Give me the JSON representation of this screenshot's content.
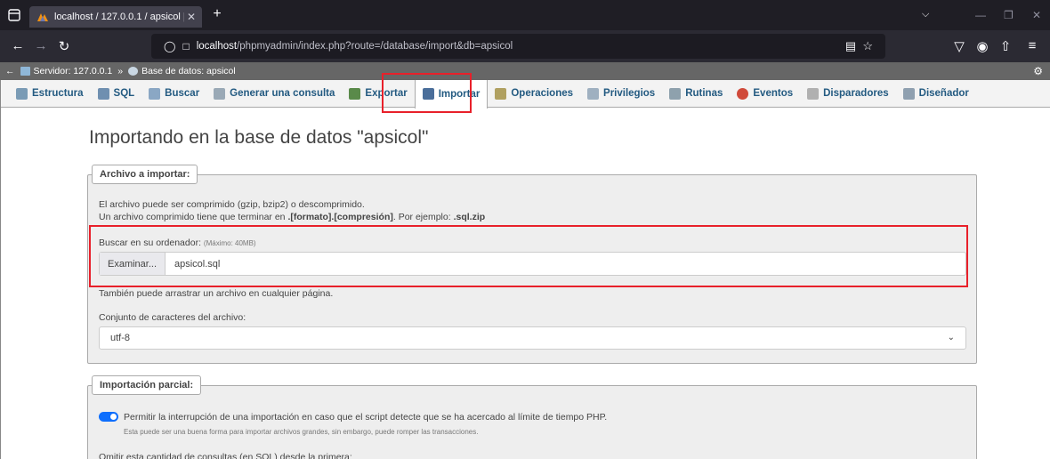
{
  "browser": {
    "tab_title": "localhost / 127.0.0.1 / apsicol | ",
    "tab_close": "✕",
    "new_tab": "+",
    "url_host": "localhost",
    "url_path": "/phpmyadmin/index.php?route=/database/import&db=apsicol"
  },
  "breadcrumb": {
    "server": "Servidor: 127.0.0.1",
    "separator": "»",
    "database": "Base de datos: apsicol"
  },
  "tabs": [
    {
      "label": "Estructura",
      "color": "#7a9bb5"
    },
    {
      "label": "SQL",
      "color": "#6f8fb0"
    },
    {
      "label": "Buscar",
      "color": "#8aa7c4"
    },
    {
      "label": "Generar una consulta",
      "color": "#9aa9b6"
    },
    {
      "label": "Exportar",
      "color": "#5a8a4a"
    },
    {
      "label": "Importar",
      "color": "#4a6e9a"
    },
    {
      "label": "Operaciones",
      "color": "#b0a060"
    },
    {
      "label": "Privilegios",
      "color": "#9fb0c0"
    },
    {
      "label": "Rutinas",
      "color": "#8ea1ad"
    },
    {
      "label": "Eventos",
      "color": "#d04a3a"
    },
    {
      "label": "Disparadores",
      "color": "#b0b0b0"
    },
    {
      "label": "Diseñador",
      "color": "#8fa0b0"
    }
  ],
  "page_title": "Importando en la base de datos \"apsicol\"",
  "file_section": {
    "legend": "Archivo a importar:",
    "line1": "El archivo puede ser comprimido (gzip, bzip2) o descomprimido.",
    "line2_prefix": "Un archivo comprimido tiene que terminar en ",
    "line2_format": ".[formato].[compresión]",
    "line2_mid": ". Por ejemplo: ",
    "line2_example": ".sql.zip",
    "browse_label": "Buscar en su ordenador:",
    "max_size": "(Máximo: 40MB)",
    "browse_button": "Examinar...",
    "file_name": "apsicol.sql",
    "drag_hint": "También puede arrastrar un archivo en cualquier página.",
    "charset_label": "Conjunto de caracteres del archivo:",
    "charset_value": "utf-8"
  },
  "partial_section": {
    "legend": "Importación parcial:",
    "allow_interrupt": "Permitir la interrupción de una importación en caso que el script detecte que se ha acercado al límite de tiempo PHP.",
    "allow_interrupt_note": "Esta puede ser una buena forma para importar archivos grandes, sin embargo, puede romper las transacciones.",
    "skip_queries": "Omitir esta cantidad de consultas (en SQL) desde la primera:"
  }
}
